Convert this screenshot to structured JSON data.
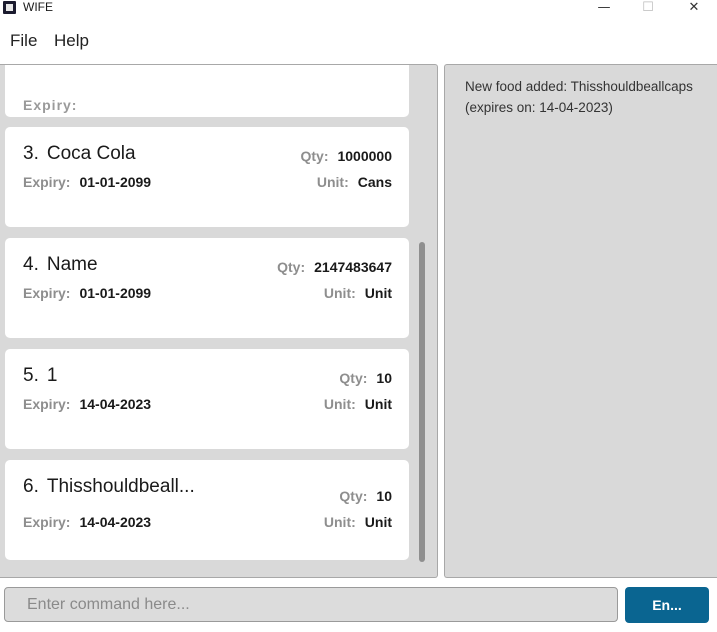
{
  "window": {
    "title": "WIFE",
    "minimize_glyph": "—",
    "maximize_glyph": "☐",
    "close_glyph": "✕"
  },
  "menu": {
    "file": "File",
    "help": "Help"
  },
  "labels": {
    "qty": "Qty:",
    "expiry": "Expiry:",
    "unit": "Unit:"
  },
  "food_list": [
    {
      "index": "3.",
      "name": "Coca Cola",
      "qty": "1000000",
      "expiry": "01-01-2099",
      "unit": "Cans"
    },
    {
      "index": "4.",
      "name": "Name",
      "qty": "2147483647",
      "expiry": "01-01-2099",
      "unit": "Unit"
    },
    {
      "index": "5.",
      "name": "1",
      "qty": "10",
      "expiry": "14-04-2023",
      "unit": "Unit"
    },
    {
      "index": "6.",
      "name": "Thisshouldbeall...",
      "qty": "10",
      "expiry": "14-04-2023",
      "unit": "Unit"
    }
  ],
  "result": {
    "message": "New food added: Thisshouldbeallcaps (expires on: 14-04-2023)"
  },
  "command": {
    "placeholder": "Enter command here...",
    "value": "",
    "button_label": "En..."
  },
  "colors": {
    "accent": "#0a6591",
    "panel_bg": "#d9d9d9",
    "card_bg": "#ffffff",
    "label_gray": "#8e8e8e"
  }
}
